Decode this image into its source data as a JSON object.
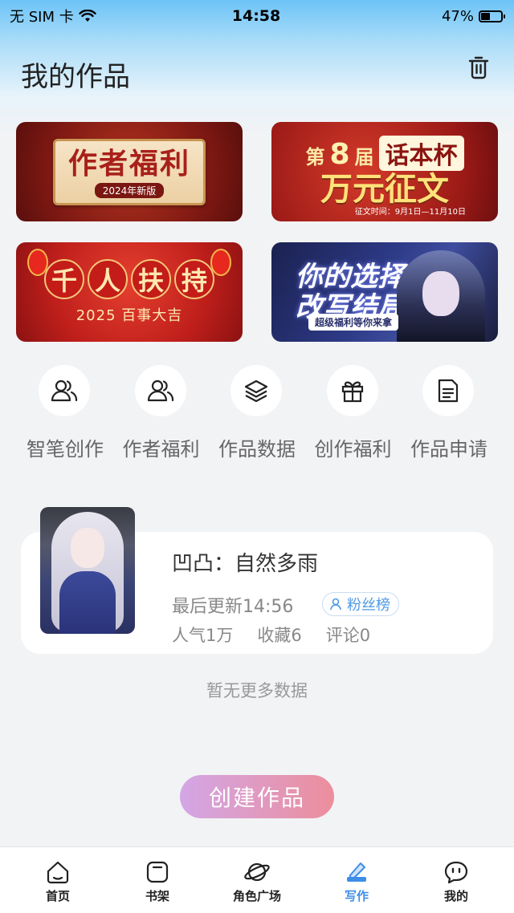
{
  "status_bar": {
    "carrier": "无 SIM 卡",
    "time": "14:58",
    "battery": "47%",
    "battery_level": 0.47
  },
  "header": {
    "title": "我的作品",
    "trash_icon": "trash-icon"
  },
  "banners": [
    {
      "title": "作者福利",
      "subtitle": "2024年新版"
    },
    {
      "prefix": "第",
      "number": "8",
      "suffix": "届",
      "brand": "话本杯",
      "main": "万元征文",
      "date": "征文时间：9月1日—11月10日"
    },
    {
      "chars": [
        "千",
        "人",
        "扶",
        "持"
      ],
      "subtitle": "2025 百事大吉"
    },
    {
      "title": "你的选择 改写结局",
      "subtitle": "超级福利等你来拿"
    }
  ],
  "shortcuts": [
    {
      "label": "智笔创作",
      "icon": "users-icon"
    },
    {
      "label": "作者福利",
      "icon": "users-icon"
    },
    {
      "label": "作品数据",
      "icon": "layers-icon"
    },
    {
      "label": "创作福利",
      "icon": "gift-icon"
    },
    {
      "label": "作品申请",
      "icon": "document-icon"
    }
  ],
  "work": {
    "title": "凹凸：自然多雨",
    "updated": "最后更新14:56",
    "badge": "粉丝榜",
    "popularity": "人气1万",
    "favorites": "收藏6",
    "comments": "评论0"
  },
  "no_more": "暂无更多数据",
  "create_button": "创建作品",
  "nav": [
    {
      "label": "首页",
      "icon": "home-icon"
    },
    {
      "label": "书架",
      "icon": "bookshelf-icon"
    },
    {
      "label": "角色广场",
      "icon": "planet-icon"
    },
    {
      "label": "写作",
      "icon": "pen-icon",
      "active": true
    },
    {
      "label": "我的",
      "icon": "chat-face-icon"
    }
  ],
  "colors": {
    "accent": "#3e8ee8",
    "create_gradient_start": "#d3a6e6",
    "create_gradient_end": "#ec8e9c"
  }
}
